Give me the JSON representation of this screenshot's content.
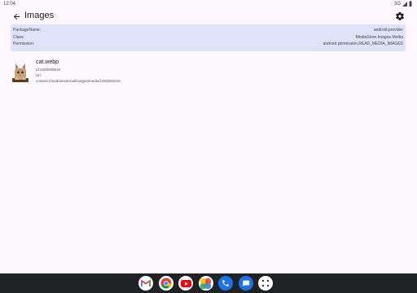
{
  "status_bar": {
    "time": "12:04",
    "network": "3G"
  },
  "app_bar": {
    "title": "Images"
  },
  "info": {
    "rows": [
      {
        "label": "PackageName:",
        "value": "android.provider"
      },
      {
        "label": "Class:",
        "value": "MediaStore.Images.Media"
      },
      {
        "label": "Permission:",
        "value": "android.permission.READ_MEDIA_IMAGES"
      }
    ]
  },
  "items": [
    {
      "name": "cat.webp",
      "id": "Id:1000000018",
      "uri_label": "Uri:",
      "uri": "content://media/external/images/media/1000000018"
    }
  ],
  "dock": {
    "apps": [
      "gmail-icon",
      "chrome-icon",
      "youtube-icon",
      "photos-icon",
      "phone-icon",
      "messages-icon",
      "app-drawer-icon"
    ]
  },
  "colors": {
    "card_bg": "#dfe3f9",
    "page_bg": "#fdf8fd",
    "nav_bg": "#202124"
  }
}
